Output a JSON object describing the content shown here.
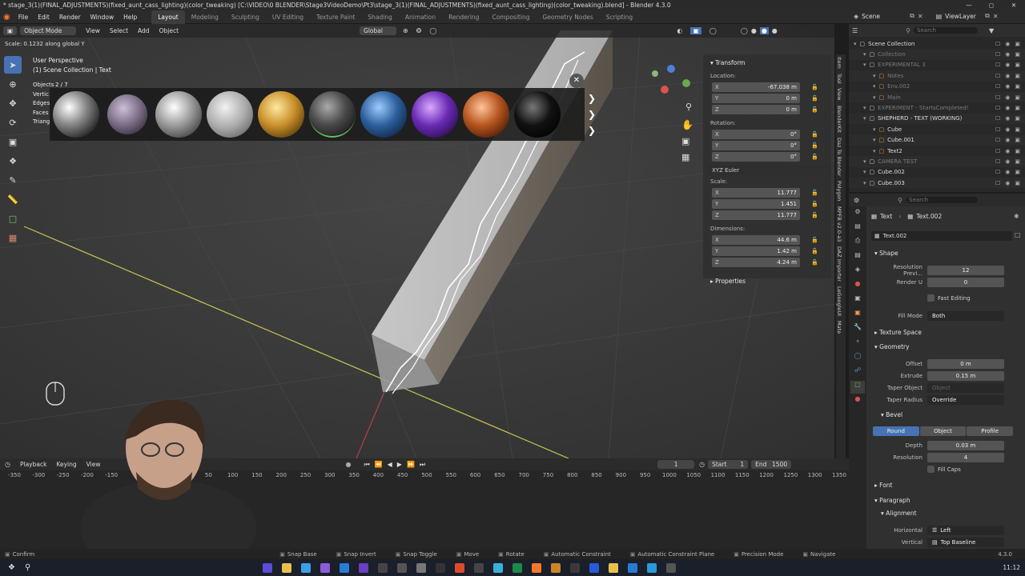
{
  "titlebar": {
    "text": "* stage_3(1)(FINAL_ADJUSTMENTS)(fixed_aunt_cass_lighting)(color_tweaking) [C:\\VIDEO\\0 BLENDER\\Stage3VideoDemo\\Pt3\\stage_3(1)(FINAL_ADJUSTMENTS)(fixed_aunt_cass_lighting)(color_tweaking).blend] - Blender 4.3.0"
  },
  "menu": [
    "File",
    "Edit",
    "Render",
    "Window",
    "Help"
  ],
  "workspaces": [
    "Layout",
    "Modeling",
    "Sculpting",
    "UV Editing",
    "Texture Paint",
    "Shading",
    "Animation",
    "Rendering",
    "Compositing",
    "Geometry Nodes",
    "Scripting"
  ],
  "scene": {
    "label": "Scene",
    "view_layer": "ViewLayer"
  },
  "viewport": {
    "mode": "Object Mode",
    "menus": [
      "View",
      "Select",
      "Add",
      "Object"
    ],
    "orientation": "Global",
    "operator_text": "Scale: 0.1232 along global Y",
    "perspective": "User Perspective",
    "collection_text": "(1) Scene Collection | Text",
    "stats": [
      {
        "label": "Objects",
        "value": "2 / 7"
      },
      {
        "label": "Vertic",
        "value": ""
      },
      {
        "label": "Edges",
        "value": ""
      },
      {
        "label": "Faces",
        "value": ""
      },
      {
        "label": "Triang",
        "value": ""
      }
    ]
  },
  "npanel": {
    "header": "Transform",
    "location_label": "Location:",
    "location": [
      {
        "ax": "X",
        "v": "-67.038 m"
      },
      {
        "ax": "Y",
        "v": "0 m"
      },
      {
        "ax": "Z",
        "v": "0 m"
      }
    ],
    "rotation_label": "Rotation:",
    "rotation": [
      {
        "ax": "X",
        "v": "0°"
      },
      {
        "ax": "Y",
        "v": "0°"
      },
      {
        "ax": "Z",
        "v": "0°"
      }
    ],
    "rotation_mode": "XYZ Euler",
    "scale_label": "Scale:",
    "scale": [
      {
        "ax": "X",
        "v": "11.777"
      },
      {
        "ax": "Y",
        "v": "1.451"
      },
      {
        "ax": "Z",
        "v": "11.777"
      }
    ],
    "dimensions_label": "Dimensions:",
    "dimensions": [
      {
        "ax": "X",
        "v": "44.6 m"
      },
      {
        "ax": "Y",
        "v": "1.42 m"
      },
      {
        "ax": "Z",
        "v": "4.24 m"
      }
    ],
    "properties_label": "Properties"
  },
  "sidetabs": [
    "Item",
    "Tool",
    "View",
    "BlenderKit",
    "Daz To Blender",
    "Polygon",
    "MPFB v2.0-a3",
    "DAZ Importer",
    "LeGoogleUI",
    "Mate"
  ],
  "outliner": {
    "search_placeholder": "Search",
    "rows": [
      {
        "name": "Scene Collection",
        "indent": 0,
        "dim": false
      },
      {
        "name": "Collection",
        "indent": 1,
        "dim": true
      },
      {
        "name": "EXPERIMENTAL 3",
        "indent": 1,
        "dim": true
      },
      {
        "name": "Notes",
        "indent": 2,
        "dim": true
      },
      {
        "name": "Env.002",
        "indent": 2,
        "dim": true
      },
      {
        "name": "Main",
        "indent": 2,
        "dim": true
      },
      {
        "name": "EXPERIMENT - StartsCompleted!",
        "indent": 1,
        "dim": true
      },
      {
        "name": "SHEPHERD - TEXT (WORKING)",
        "indent": 1,
        "dim": false
      },
      {
        "name": "Cube",
        "indent": 2,
        "dim": false
      },
      {
        "name": "Cube.001",
        "indent": 2,
        "dim": false
      },
      {
        "name": "Text2",
        "indent": 2,
        "dim": false
      },
      {
        "name": "CAMERA TEST",
        "indent": 1,
        "dim": true
      },
      {
        "name": "Cube.002",
        "indent": 1,
        "dim": false
      },
      {
        "name": "Cube.003",
        "indent": 1,
        "dim": false
      }
    ]
  },
  "properties": {
    "search_placeholder": "Search",
    "breadcrumb_obj": "Text",
    "breadcrumb_data": "Text.002",
    "datablock": "Text.002",
    "shape_section": "Shape",
    "resolution_preview": {
      "label": "Resolution Previ...",
      "value": "12"
    },
    "render_u": {
      "label": "Render U",
      "value": "0"
    },
    "fast_editing": "Fast Editing",
    "fill_mode": {
      "label": "Fill Mode",
      "value": "Both"
    },
    "texture_space": "Texture Space",
    "geometry_section": "Geometry",
    "offset": {
      "label": "Offset",
      "value": "0 m"
    },
    "extrude": {
      "label": "Extrude",
      "value": "0.15 m"
    },
    "taper_object": {
      "label": "Taper Object",
      "value": "Object"
    },
    "taper_radius": {
      "label": "Taper Radius",
      "value": "Override"
    },
    "bevel_section": "Bevel",
    "bevel_tabs": [
      "Round",
      "Object",
      "Profile"
    ],
    "depth": {
      "label": "Depth",
      "value": "0.03 m"
    },
    "resolution": {
      "label": "Resolution",
      "value": "4"
    },
    "fill_caps": "Fill Caps",
    "font_section": "Font",
    "paragraph_section": "Paragraph",
    "alignment_section": "Alignment",
    "horizontal": {
      "label": "Horizontal",
      "value": "Left"
    },
    "vertical": {
      "label": "Vertical",
      "value": "Top Baseline"
    }
  },
  "timeline": {
    "menus": [
      "Playback",
      "Keying",
      "View"
    ],
    "current_frame": "1",
    "start_label": "Start",
    "start": "1",
    "end_label": "End",
    "end": "1500",
    "ruler": [
      "-350",
      "-300",
      "-250",
      "-200",
      "-150",
      "50",
      "100",
      "150",
      "200",
      "250",
      "300",
      "350",
      "400",
      "450",
      "500",
      "550",
      "600",
      "650",
      "700",
      "750",
      "800",
      "850",
      "900",
      "950",
      "1000",
      "1050",
      "1100",
      "1150",
      "1200",
      "1250",
      "1300",
      "1350"
    ]
  },
  "statusbar": {
    "items": [
      "Confirm",
      "Snap Base",
      "Snap Invert",
      "Snap Toggle",
      "Move",
      "Rotate",
      "Automatic Constraint",
      "Automatic Constraint Plane",
      "Precision Mode",
      "Navigate"
    ],
    "version": "4.3.0"
  },
  "taskbar": {
    "clock": "11:12"
  },
  "colors": {
    "accent": "#4772b3",
    "x_axis": "#c8c850",
    "y_axis": "#c84050",
    "outline": "#ffffff"
  }
}
